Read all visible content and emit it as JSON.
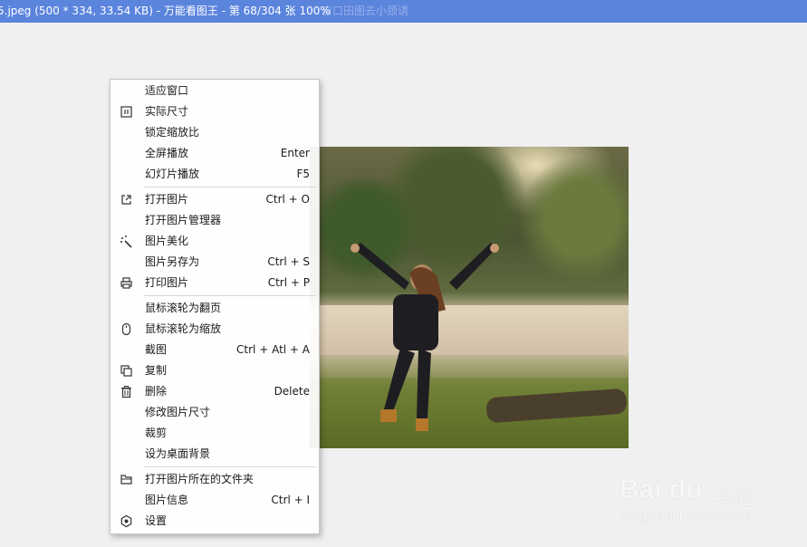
{
  "titlebar": {
    "title": "5.jpeg (500 * 334, 33.54 KB) - 万能看图王 - 第 68/304 张 100%",
    "ghost_text": "自口田图去小颈诱"
  },
  "menu": {
    "items": [
      {
        "label": "适应窗口",
        "shortcut": "",
        "icon": ""
      },
      {
        "label": "实际尺寸",
        "shortcut": "",
        "icon": "actual-size-icon"
      },
      {
        "label": "锁定缩放比",
        "shortcut": "",
        "icon": ""
      },
      {
        "label": "全屏播放",
        "shortcut": "Enter",
        "icon": ""
      },
      {
        "label": "幻灯片播放",
        "shortcut": "F5",
        "icon": ""
      },
      {
        "label": "打开图片",
        "shortcut": "Ctrl + O",
        "icon": "open-external-icon"
      },
      {
        "label": "打开图片管理器",
        "shortcut": "",
        "icon": ""
      },
      {
        "label": "图片美化",
        "shortcut": "",
        "icon": "magic-wand-icon"
      },
      {
        "label": "图片另存为",
        "shortcut": "Ctrl + S",
        "icon": ""
      },
      {
        "label": "打印图片",
        "shortcut": "Ctrl + P",
        "icon": "printer-icon"
      },
      {
        "label": "鼠标滚轮为翻页",
        "shortcut": "",
        "icon": ""
      },
      {
        "label": "鼠标滚轮为缩放",
        "shortcut": "",
        "icon": "mouse-icon"
      },
      {
        "label": "截图",
        "shortcut": "Ctrl + Atl + A",
        "icon": ""
      },
      {
        "label": "复制",
        "shortcut": "",
        "icon": "copy-icon"
      },
      {
        "label": "删除",
        "shortcut": "Delete",
        "icon": "trash-icon"
      },
      {
        "label": "修改图片尺寸",
        "shortcut": "",
        "icon": ""
      },
      {
        "label": "裁剪",
        "shortcut": "",
        "icon": ""
      },
      {
        "label": "设为桌面背景",
        "shortcut": "",
        "icon": ""
      },
      {
        "label": "打开图片所在的文件夹",
        "shortcut": "",
        "icon": "folder-icon"
      },
      {
        "label": "图片信息",
        "shortcut": "Ctrl + I",
        "icon": ""
      },
      {
        "label": "设置",
        "shortcut": "",
        "icon": "settings-icon"
      }
    ]
  },
  "watermark": {
    "brand": "Bai du",
    "brand_cn": "经验",
    "url": "jingyan.baidu.com"
  },
  "colors": {
    "titlebar": "#5b84dd",
    "background": "#f0f0f0",
    "menu_bg": "#ffffff"
  }
}
